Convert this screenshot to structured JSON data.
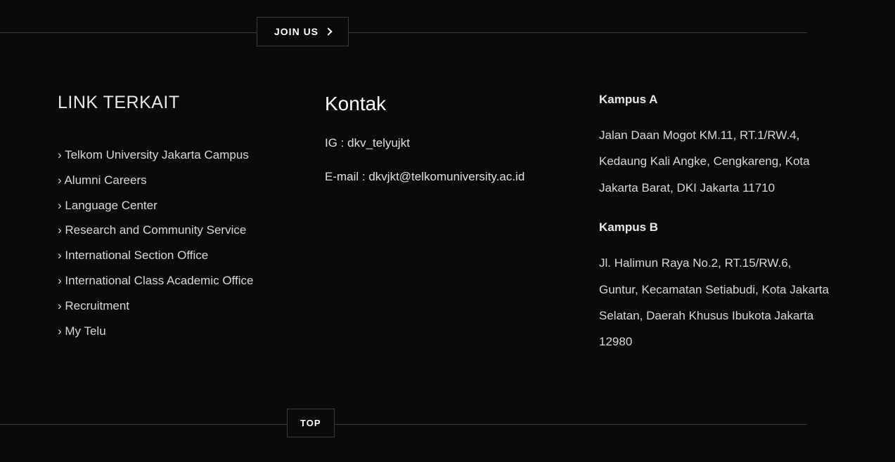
{
  "join_button": "JOIN US",
  "top_button": "TOP",
  "links": {
    "heading": "LINK TERKAIT",
    "items": [
      "Telkom University Jakarta Campus",
      "Alumni Careers",
      "Language Center",
      "Research and Community Service",
      "International Section Office",
      "International Class Academic Office",
      "Recruitment",
      "My Telu"
    ]
  },
  "contact": {
    "heading": "Kontak",
    "ig": "IG : dkv_telyujkt",
    "email": "E-mail : dkvjkt@telkomuniversity.ac.id"
  },
  "campus_a": {
    "heading": "Kampus A",
    "address": "Jalan Daan Mogot KM.11, RT.1/RW.4, Kedaung Kali Angke, Cengkareng, Kota Jakarta Barat, DKI Jakarta 11710"
  },
  "campus_b": {
    "heading": "Kampus B",
    "address": "Jl. Halimun Raya No.2, RT.15/RW.6, Guntur, Kecamatan Setiabudi, Kota Jakarta Selatan, Daerah Khusus Ibukota Jakarta 12980"
  }
}
